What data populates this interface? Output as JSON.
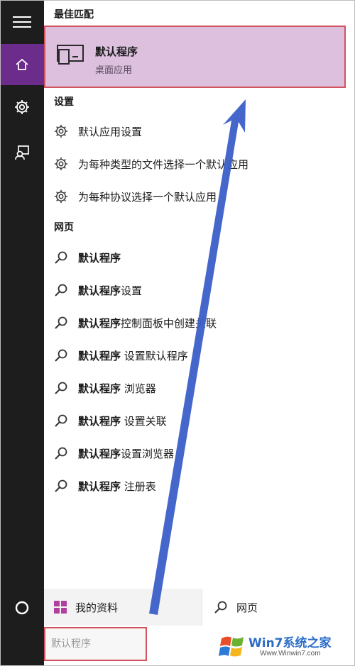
{
  "sections": {
    "best_match": "最佳匹配",
    "settings": "设置",
    "web": "网页"
  },
  "best_match": {
    "title": "默认程序",
    "subtitle": "桌面应用"
  },
  "settings_items": [
    {
      "label": "默认应用设置"
    },
    {
      "label": "为每种类型的文件选择一个默认应用"
    },
    {
      "label": "为每种协议选择一个默认应用"
    }
  ],
  "web_items": [
    {
      "bold": "默认程序",
      "rest": ""
    },
    {
      "bold": "默认程序",
      "rest": "设置"
    },
    {
      "bold": "默认程序",
      "rest": "控制面板中创建关联"
    },
    {
      "bold": "默认程序",
      "rest": " 设置默认程序"
    },
    {
      "bold": "默认程序",
      "rest": " 浏览器"
    },
    {
      "bold": "默认程序",
      "rest": " 设置关联"
    },
    {
      "bold": "默认程序",
      "rest": "设置浏览器"
    },
    {
      "bold": "默认程序",
      "rest": " 注册表"
    }
  ],
  "bottom": {
    "my_data": "我的资料",
    "web": "网页"
  },
  "search": {
    "placeholder": "默认程序"
  },
  "watermark": {
    "brand": "Win7系统之家",
    "url": "Www.Winwin7.com"
  },
  "colors": {
    "rail": "#1d1d1d",
    "accent": "#6c2c8c",
    "highlight": "#dcc0de",
    "outline": "#d2525e",
    "arrow": "#3b5fc8"
  },
  "icons": {
    "rail": [
      "hamburger-menu-icon",
      "home-icon",
      "gear-icon",
      "feedback-icon",
      "cortana-circle-icon"
    ],
    "best_match": "desktop-app-icon",
    "settings": "gear-icon",
    "web": "search-icon",
    "my_data": "windows-logo-icon"
  }
}
